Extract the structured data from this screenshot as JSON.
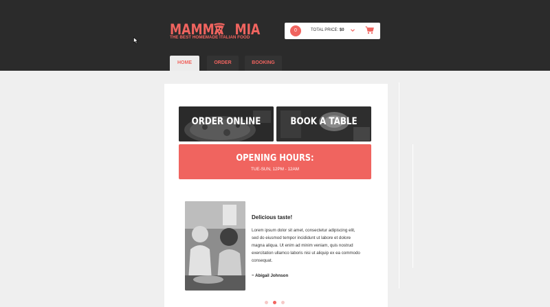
{
  "brand": {
    "name_left": "MAMMA",
    "name_right": "MIA",
    "tagline": "THE BEST HOMEMADE ITALIAN FOOD",
    "accent_color": "#f0645f"
  },
  "cart": {
    "count": "0",
    "total_label": "TOTAL PRICE:",
    "total_value": "$0",
    "chevron_icon": "chevron-down-icon",
    "cart_icon": "shopping-cart-icon"
  },
  "nav": {
    "tabs": [
      {
        "label": "HOME",
        "active": true
      },
      {
        "label": "ORDER",
        "active": false
      },
      {
        "label": "BOOKING",
        "active": false
      }
    ]
  },
  "main": {
    "tiles": [
      {
        "label": "ORDER ONLINE"
      },
      {
        "label": "BOOK A TABLE"
      }
    ],
    "hours": {
      "title": "OPENING HOURS:",
      "subtitle": "TUE-SUN, 12PM - 12AM"
    }
  },
  "testimonial": {
    "title": "Delicious taste!",
    "body": "Lorem ipsum dolor sit amet, consectetur adipiscing elit, sed do eiusmod tempor incididunt ut labore et dolore magna aliqua. Ut enim ad minim veniam, quis nostrud exercitation ullamco laboris nisi ut aliquip ex ea commodo consequat.",
    "author": "~ Abigail Johnson",
    "slides": 3,
    "active_slide": 2
  }
}
